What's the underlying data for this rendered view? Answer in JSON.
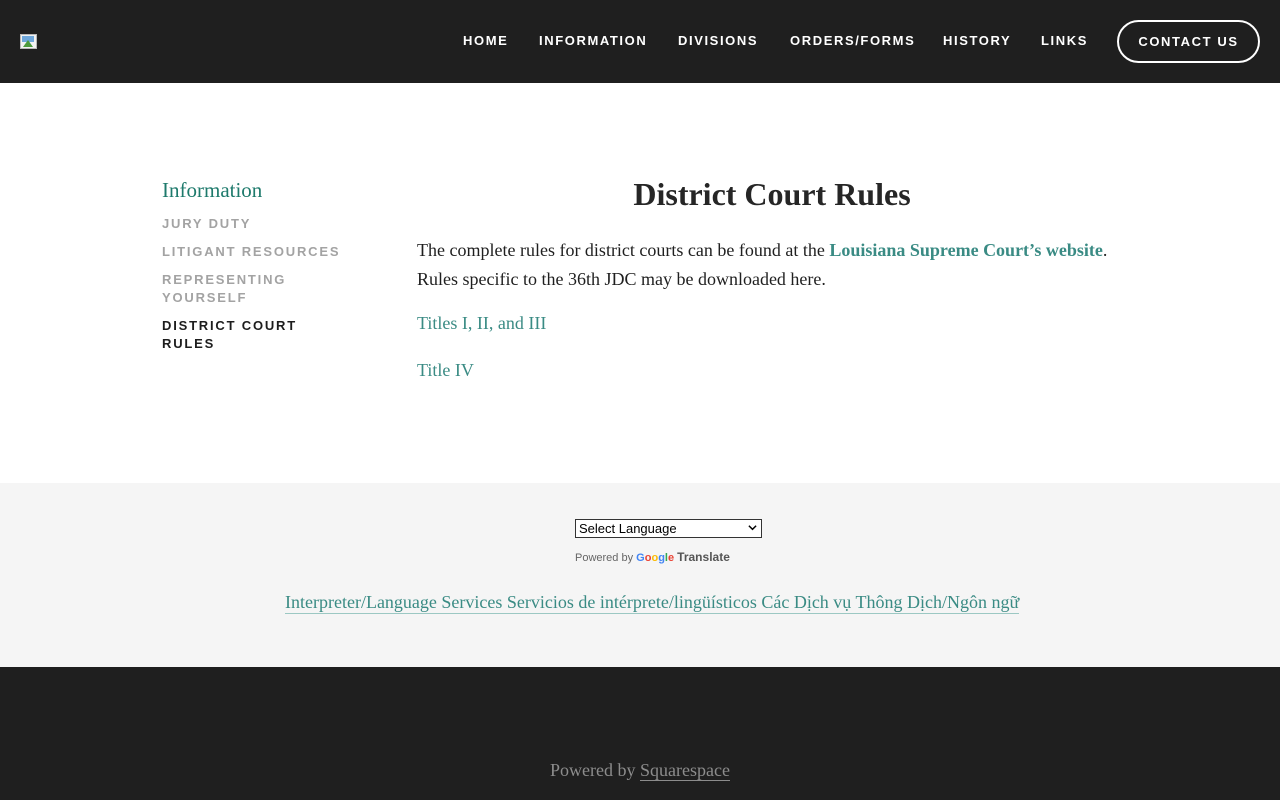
{
  "header": {
    "logo_icon": "broken-image-icon",
    "nav": [
      {
        "label": "HOME"
      },
      {
        "label": "INFORMATION"
      },
      {
        "label": "DIVISIONS"
      },
      {
        "label": "ORDERS/FORMS"
      },
      {
        "label": "HISTORY"
      },
      {
        "label": "LINKS"
      }
    ],
    "contact_label": "CONTACT US"
  },
  "sidebar": {
    "title": "Information",
    "items": [
      {
        "label": "JURY DUTY"
      },
      {
        "label": "LITIGANT RESOURCES"
      },
      {
        "label": "REPRESENTING YOURSELF"
      },
      {
        "label": "DISTRICT COURT RULES"
      }
    ]
  },
  "main": {
    "title": "District Court Rules",
    "para_before": "The complete rules for district courts can be found at the ",
    "para_link": "Louisiana Supreme Court’s website",
    "para_after": ". Rules specific to the 36th JDC may be downloaded here.",
    "links": [
      {
        "label": "Titles I, II, and III"
      },
      {
        "label": "Title IV"
      }
    ]
  },
  "translate": {
    "select_value": "Select Language",
    "powered_by": "Powered by",
    "google": "Google",
    "translate_label": "Translate",
    "interpreter_link": "Interpreter/Language Services Servicios de intérprete/lingüísticos Các Dịch vụ Thông Dịch/Ngôn ngữ"
  },
  "footer": {
    "powered_by": "Powered by ",
    "squarespace": "Squarespace"
  },
  "colors": {
    "header_bg": "#1f1f1f",
    "accent_teal": "#3a8b84",
    "sidebar_title": "#1e7a6c",
    "band_bg": "#f5f5f5"
  }
}
